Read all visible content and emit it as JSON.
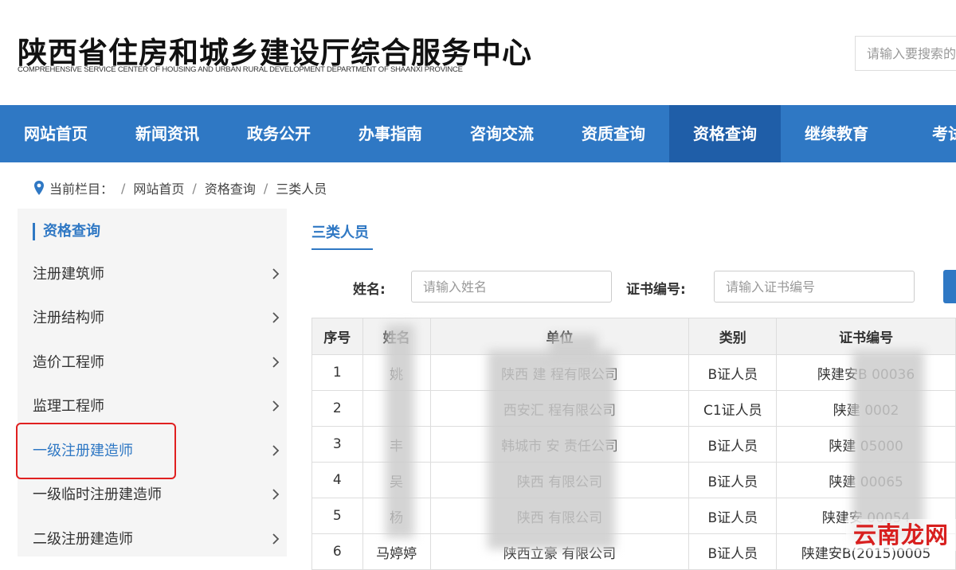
{
  "header": {
    "title": "陕西省住房和城乡建设厅综合服务中心",
    "subtitle": "COMPREHENSIVE SERVICE CENTER OF HOUSING AND URBAN RURAL DEVELOPMENT DEPARTMENT OF SHAANXI PROVINCE",
    "search_placeholder": "请输入要搜索的"
  },
  "nav": {
    "items": [
      "网站首页",
      "新闻资讯",
      "政务公开",
      "办事指南",
      "咨询交流",
      "资质查询",
      "资格查询",
      "继续教育",
      "考试"
    ],
    "active": "资格查询"
  },
  "breadcrumb": {
    "prefix": "当前栏目：",
    "items": [
      "网站首页",
      "资格查询",
      "三类人员"
    ]
  },
  "sidebar": {
    "title": "资格查询",
    "items": [
      "注册建筑师",
      "注册结构师",
      "造价工程师",
      "监理工程师",
      "一级注册建造师",
      "一级临时注册建造师",
      "二级注册建造师"
    ]
  },
  "main": {
    "tab": "三类人员",
    "name_label": "姓名:",
    "name_placeholder": "请输入姓名",
    "cert_label": "证书编号:",
    "cert_placeholder": "请输入证书编号"
  },
  "table": {
    "headers": [
      "序号",
      "姓名",
      "单位",
      "类别",
      "证书编号"
    ],
    "rows": [
      [
        "1",
        "姚",
        "陕西  建    程有限公司",
        "B证人员",
        "陕建安B      00036"
      ],
      [
        "2",
        "",
        "西安汇            程有限公司",
        "C1证人员",
        "陕建        0002"
      ],
      [
        "3",
        "丰",
        "韩城市        安    责任公司",
        "B证人员",
        "陕建        05000"
      ],
      [
        "4",
        "吴",
        "陕西              有限公司",
        "B证人员",
        "陕建        00065"
      ],
      [
        "5",
        "杨",
        "陕西              有限公司",
        "B证人员",
        "陕建安        00054"
      ],
      [
        "6",
        "马婷婷",
        "陕西立豪      有限公司",
        "B证人员",
        "陕建安B(2015)0005"
      ]
    ]
  },
  "watermark": "云南龙网",
  "colors": {
    "nav": "#2f78c4",
    "nav_active": "#1f5ea8",
    "highlight": "#e02020"
  }
}
